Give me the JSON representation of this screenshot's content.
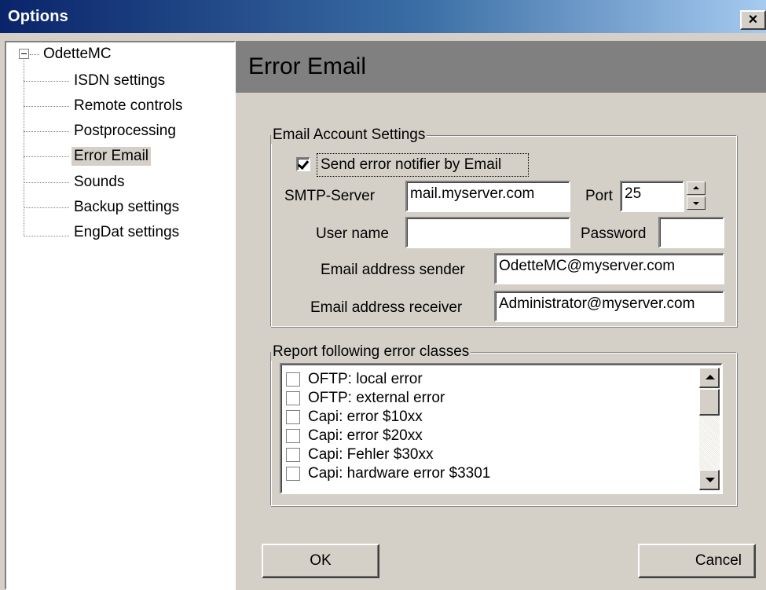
{
  "window": {
    "title": "Options",
    "close_glyph": "×"
  },
  "tree": {
    "root": "OdetteMC",
    "items": [
      {
        "label": "ISDN settings"
      },
      {
        "label": "Remote controls"
      },
      {
        "label": "Postprocessing"
      },
      {
        "label": "Error Email",
        "selected": true
      },
      {
        "label": "Sounds"
      },
      {
        "label": "Backup settings"
      },
      {
        "label": "EngDat settings"
      }
    ]
  },
  "panel": {
    "title": "Error Email"
  },
  "account": {
    "legend": "Email Account Settings",
    "send_checkbox_label": "Send error notifier by Email",
    "send_checked": true,
    "smtp_label": "SMTP-Server",
    "smtp_value": "mail.myserver.com",
    "port_label": "Port",
    "port_value": "25",
    "user_label": "User name",
    "user_value": "",
    "password_label": "Password",
    "password_value": "",
    "sender_label": "Email address sender",
    "sender_value": "OdetteMC@myserver.com",
    "receiver_label": "Email address receiver",
    "receiver_value": "Administrator@myserver.com"
  },
  "errors": {
    "legend": "Report following error classes",
    "items": [
      {
        "label": "OFTP: local error",
        "checked": false
      },
      {
        "label": "OFTP: external error",
        "checked": false
      },
      {
        "label": "Capi: error $10xx",
        "checked": false
      },
      {
        "label": "Capi: error $20xx",
        "checked": false
      },
      {
        "label": "Capi: Fehler $30xx",
        "checked": false
      },
      {
        "label": "Capi: hardware error $3301",
        "checked": false
      }
    ]
  },
  "buttons": {
    "ok": "OK",
    "cancel": "Cancel"
  },
  "icons": {
    "expander": "minus-box-icon",
    "scroll_up": "arrow-up-icon",
    "scroll_down": "arrow-down-icon",
    "spin_up": "spin-up-icon",
    "spin_down": "spin-down-icon"
  }
}
